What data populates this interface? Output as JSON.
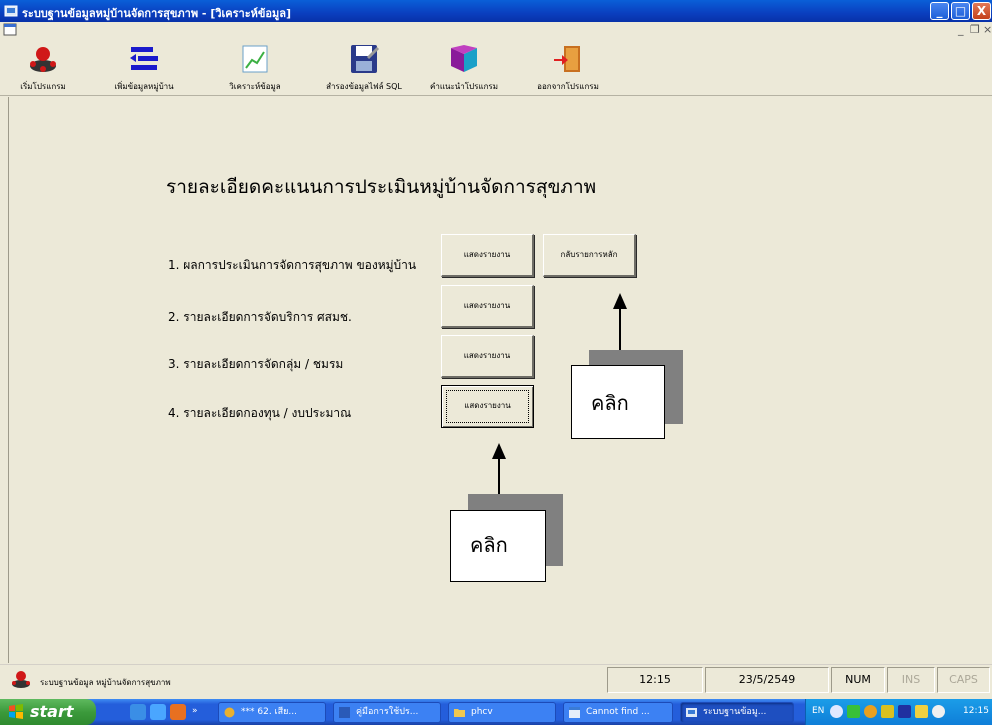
{
  "window": {
    "title": "ระบบฐานข้อมูลหมู่บ้านจัดการสุขภาพ - [วิเคราะห์ข้อมูล]",
    "controls": {
      "minimize": "_",
      "maximize": "□",
      "close": "X"
    },
    "mdi_controls": {
      "minimize": "_",
      "restore": "❐",
      "close": "×"
    }
  },
  "toolbar": {
    "items": [
      {
        "label": "เริ่มโปรแกรม",
        "icon": "people-circle-icon"
      },
      {
        "label": "เพิ่มข้อมูลหมู่บ้าน",
        "icon": "list-add-icon"
      },
      {
        "label": "วิเคราะห์ข้อมูล",
        "icon": "chart-icon"
      },
      {
        "label": "สำรองข้อมูลไฟล์ SQL",
        "icon": "floppy-disk-icon"
      },
      {
        "label": "คำแนะนำโปรแกรม",
        "icon": "book-icon"
      },
      {
        "label": "ออกจากโปรแกรม",
        "icon": "exit-door-icon"
      }
    ]
  },
  "main": {
    "heading": "รายละเอียดคะแนนการประเมินหมู่บ้านจัดการสุขภาพ",
    "rows": [
      {
        "label": "1. ผลการประเมินการจัดการสุขภาพ ของหมู่บ้าน",
        "button": "แสดงรายงาน"
      },
      {
        "label": "2. รายละเอียดการจัดบริการ ศสมช.",
        "button": "แสดงรายงาน"
      },
      {
        "label": "3. รายละเอียดการจัดกลุ่ม / ชมรม",
        "button": "แสดงรายงาน"
      },
      {
        "label": "4. รายละเอียดกองทุน / งบประมาณ",
        "button": "แสดงรายงาน"
      }
    ],
    "back_button": "กลับรายการหลัก",
    "callouts": [
      "คลิก",
      "คลิก"
    ]
  },
  "statusbar": {
    "text": "ระบบฐานข้อมูล หมู่บ้านจัดการสุขภาพ",
    "time": "12:15",
    "date": "23/5/2549",
    "num": "NUM",
    "ins": "INS",
    "caps": "CAPS"
  },
  "taskbar": {
    "start": "start",
    "tasks": [
      {
        "label": "*** 62. เสีย...",
        "active": false
      },
      {
        "label": "คู่มือการใช้ปร...",
        "active": false
      },
      {
        "label": "phcv",
        "active": false
      },
      {
        "label": "Cannot find ...",
        "active": false
      },
      {
        "label": "ระบบฐานข้อมู...",
        "active": true
      }
    ],
    "lang": "EN",
    "clock": "12:15"
  },
  "colors": {
    "title_blue": "#0a3fbf",
    "window_bg": "#ece9d8",
    "start_green": "#3c9a3c",
    "taskbar_blue": "#245edb"
  }
}
